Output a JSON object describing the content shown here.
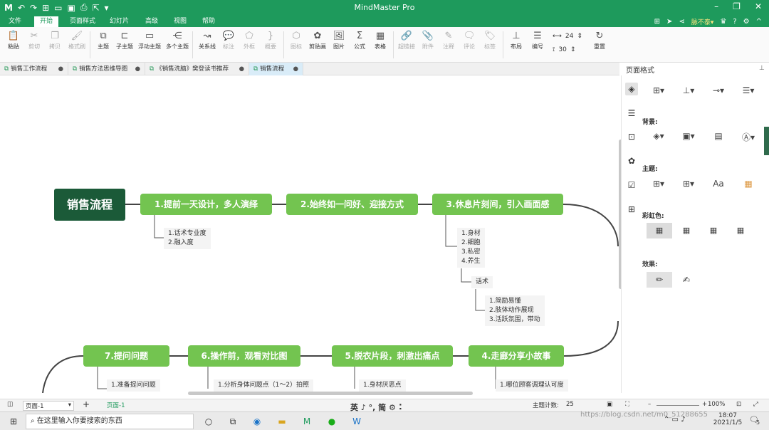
{
  "app": {
    "title": "MindMaster Pro"
  },
  "quick_icons": [
    "app-logo-icon",
    "undo-icon",
    "redo-icon",
    "new-icon",
    "open-icon",
    "save-icon",
    "print-icon",
    "export-icon",
    "more-icon"
  ],
  "menus": [
    "文件",
    "开始",
    "页面样式",
    "幻灯片",
    "高级",
    "视图",
    "帮助"
  ],
  "active_menu": "开始",
  "user": {
    "name": "脉不泰▾"
  },
  "ribbon": [
    {
      "label": "粘贴",
      "icon": "paste-icon",
      "enabled": true
    },
    {
      "label": "剪切",
      "icon": "cut-icon",
      "enabled": false
    },
    {
      "label": "拷贝",
      "icon": "copy-icon",
      "enabled": false
    },
    {
      "label": "格式刷",
      "icon": "format-painter-icon",
      "enabled": false
    },
    {
      "label": "主题",
      "icon": "topic-icon",
      "enabled": true
    },
    {
      "label": "子主题",
      "icon": "subtopic-icon",
      "enabled": true
    },
    {
      "label": "浮动主题",
      "icon": "floating-topic-icon",
      "enabled": true
    },
    {
      "label": "多个主题",
      "icon": "multiple-topics-icon",
      "enabled": true
    },
    {
      "label": "关系线",
      "icon": "relationship-icon",
      "enabled": true
    },
    {
      "label": "标注",
      "icon": "callout-icon",
      "enabled": false
    },
    {
      "label": "外框",
      "icon": "boundary-icon",
      "enabled": false
    },
    {
      "label": "概要",
      "icon": "summary-icon",
      "enabled": false
    },
    {
      "label": "图标",
      "icon": "mark-icon",
      "enabled": false
    },
    {
      "label": "剪贴画",
      "icon": "clipart-icon",
      "enabled": true
    },
    {
      "label": "图片",
      "icon": "picture-icon",
      "enabled": true
    },
    {
      "label": "公式",
      "icon": "formula-icon",
      "enabled": true
    },
    {
      "label": "表格",
      "icon": "table-icon",
      "enabled": true
    },
    {
      "label": "超链接",
      "icon": "hyperlink-icon",
      "enabled": false
    },
    {
      "label": "附件",
      "icon": "attachment-icon",
      "enabled": false
    },
    {
      "label": "注释",
      "icon": "note-icon",
      "enabled": false
    },
    {
      "label": "评论",
      "icon": "comment-icon",
      "enabled": false
    },
    {
      "label": "标签",
      "icon": "tag-icon",
      "enabled": false
    },
    {
      "label": "布局",
      "icon": "layout-icon",
      "enabled": true
    },
    {
      "label": "编号",
      "icon": "numbering-icon",
      "enabled": true
    },
    {
      "label": "重置",
      "icon": "reset-icon",
      "enabled": true
    }
  ],
  "spacing": {
    "horizontal": "24",
    "vertical": "30"
  },
  "doc_tabs": [
    {
      "label": "销售工作流程",
      "active": false
    },
    {
      "label": "销售方法思维导图",
      "active": false
    },
    {
      "label": "《销售洗脑》樊登读书推荐",
      "active": false
    },
    {
      "label": "销售流程",
      "active": true
    }
  ],
  "mindmap": {
    "root": "销售流程",
    "topics": [
      "1.提前一天设计，多人演绎",
      "2.始终如一问好、迎接方式",
      "3.休息片刻间，引入画面感",
      "4.走廊分享小故事",
      "5.脱衣片段，刺激出痛点",
      "6.操作前，观看对比图",
      "7.提问问题"
    ],
    "subs": [
      "1.话术专业度\n2.融入度",
      "1.身材\n2.细胞\n3.私密\n4.养生",
      "话术",
      "1.简励易懂\n2.肢体动作展现\n3.活跃氛围，带动",
      "1.哪位顾客调理认可度",
      "1.身材厌恶点",
      "1.分析身体问题点（1～2）拍照",
      "1.准备提问问题"
    ]
  },
  "panel": {
    "title": "页面格式",
    "background_label": "背景:",
    "theme_label": "主题:",
    "rainbow_label": "彩虹色:",
    "effects_label": "效果:",
    "theme_font": "Aa"
  },
  "status": {
    "page_selector": "页面-1",
    "page_tab": "页面-1",
    "topic_count_label": "主题计数:",
    "topic_count": "25",
    "zoom": "100%"
  },
  "taskbar": {
    "search_placeholder": "在这里输入你要搜索的东西",
    "time": "18:07",
    "date": "2021/1/5",
    "ime": "英 ♪ °, 简 ⚙ ⠅",
    "notification_count": "5"
  },
  "watermark": "https://blog.csdn.net/m0_51288655",
  "colors": {
    "brand": "#1e9a5c",
    "root": "#1b5a38",
    "topic": "#73c450"
  }
}
